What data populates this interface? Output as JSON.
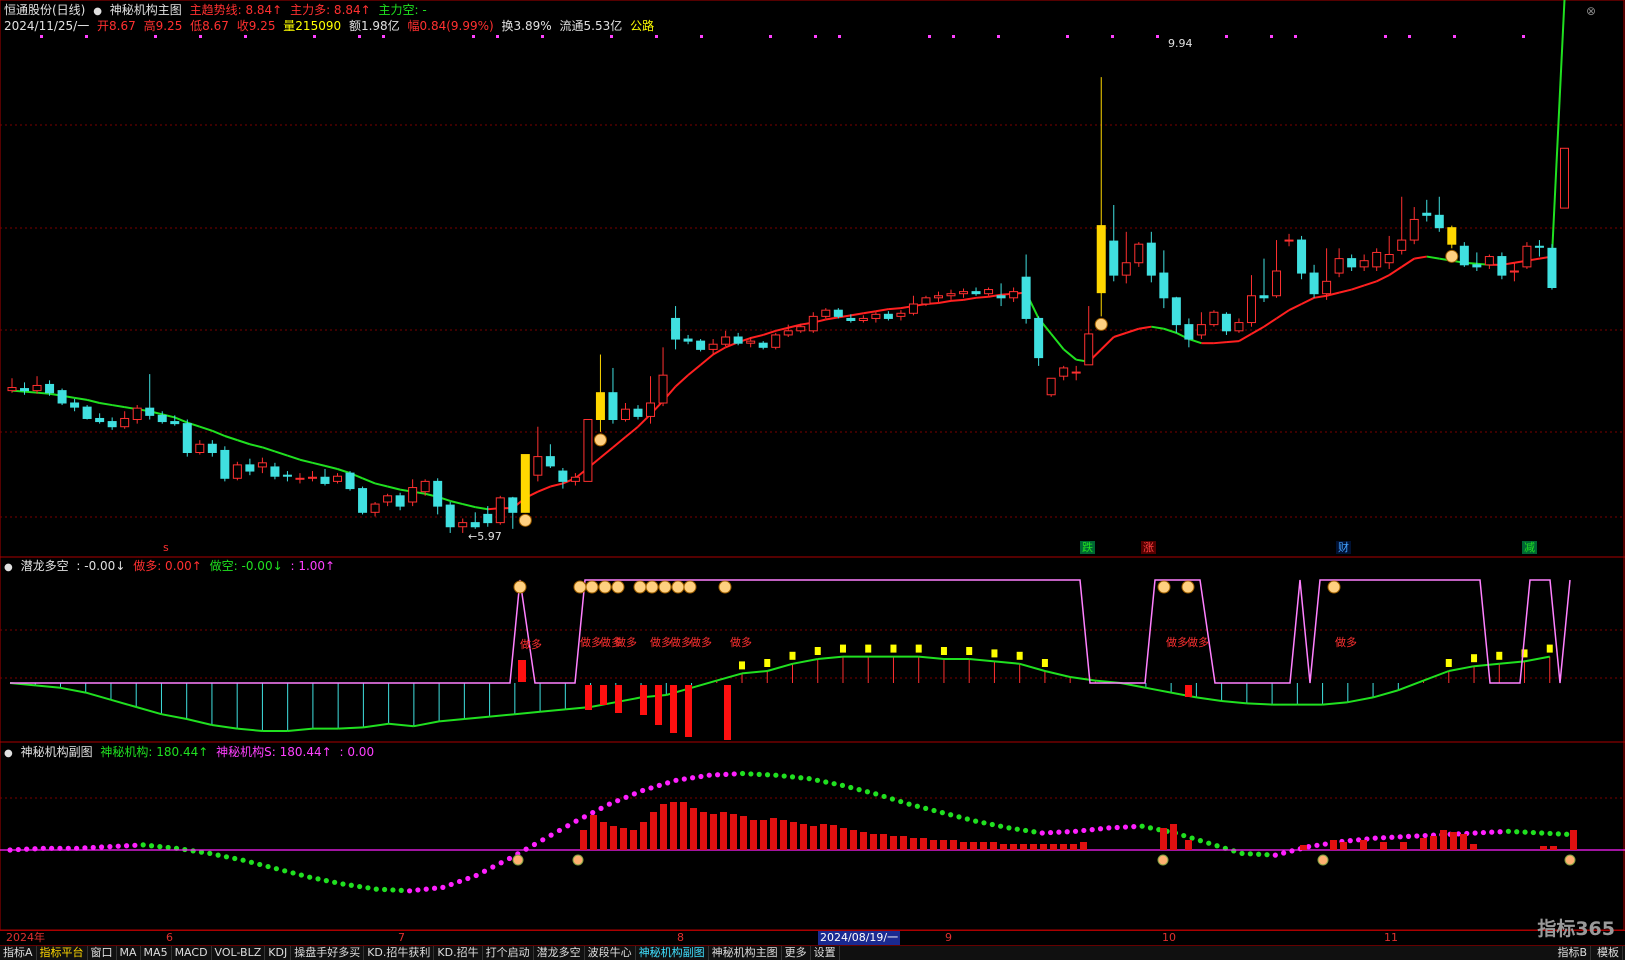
{
  "header": {
    "title": "恒通股份(日线)",
    "indicator": "神秘机构主图",
    "trend_label": "主趋势线: 8.84↑",
    "main_long": "主力多: 8.84↑",
    "main_short": "主力空: -",
    "date": "2024/11/25/一",
    "open": "开8.67",
    "high": "高9.25",
    "low": "低8.67",
    "close": "收9.25",
    "volume": "量215090",
    "amount": "额1.98亿",
    "change": "幅0.84(9.99%)",
    "turnover": "换3.89%",
    "float": "流通5.53亿",
    "concept": "公路"
  },
  "price_labels": {
    "high": "9.94",
    "low": "5.97"
  },
  "event_markers": {
    "s": "s",
    "fall": "跌",
    "rise": "涨",
    "finance": "财",
    "reduce": "减"
  },
  "sub1": {
    "name": "潜龙多空",
    "v0": ": -0.00↓",
    "long": "做多: 0.00↑",
    "short": "做空: -0.00↓",
    "v3": ": 1.00↑",
    "signal_text": "做多"
  },
  "sub2": {
    "name": "神秘机构副图",
    "s1": "神秘机构: 180.44↑",
    "s2": "神秘机构S: 180.44↑",
    "s3": ": 0.00"
  },
  "x_axis": {
    "labels": [
      "2024年",
      "6",
      "7",
      "8",
      "2024/08/19/一",
      "9",
      "10",
      "11"
    ]
  },
  "tabs": [
    "指标A",
    "指标平台",
    "窗口",
    "MA",
    "MA5",
    "MACD",
    "VOL-BLZ",
    "KDJ",
    "操盘手好多买",
    "KD.招牛获利",
    "KD.招牛",
    "打个启动",
    "潜龙多空",
    "波段牛心",
    "神秘机构副图",
    "神秘机构主图",
    "更多",
    "设置"
  ],
  "tabs_right": [
    "指标B",
    "模板"
  ],
  "logo": "指标365",
  "colors": {
    "up": "#ff3030",
    "down": "#40e0e0",
    "ma_up": "#ff2020",
    "ma_down": "#20e020",
    "signal": "#ffd700"
  },
  "chart_data": {
    "type": "candlestick",
    "price_range": [
      5.5,
      10.3
    ],
    "candles": [
      [
        6.9,
        6.93,
        6.88,
        7.02
      ],
      [
        6.92,
        6.9,
        6.86,
        6.98
      ],
      [
        6.9,
        6.95,
        6.87,
        7.04
      ],
      [
        6.96,
        6.88,
        6.85,
        7.0
      ],
      [
        6.9,
        6.78,
        6.76,
        6.92
      ],
      [
        6.78,
        6.74,
        6.7,
        6.82
      ],
      [
        6.74,
        6.63,
        6.62,
        6.76
      ],
      [
        6.63,
        6.6,
        6.58,
        6.68
      ],
      [
        6.6,
        6.55,
        6.52,
        6.64
      ],
      [
        6.55,
        6.63,
        6.53,
        6.7
      ],
      [
        6.62,
        6.73,
        6.58,
        6.76
      ],
      [
        6.73,
        6.66,
        6.62,
        7.06
      ],
      [
        6.66,
        6.6,
        6.58,
        6.7
      ],
      [
        6.6,
        6.58,
        6.56,
        6.66
      ],
      [
        6.58,
        6.3,
        6.26,
        6.62
      ],
      [
        6.3,
        6.38,
        6.28,
        6.42
      ],
      [
        6.38,
        6.3,
        6.26,
        6.42
      ],
      [
        6.32,
        6.05,
        6.02,
        6.36
      ],
      [
        6.05,
        6.18,
        6.03,
        6.21
      ],
      [
        6.18,
        6.12,
        6.08,
        6.24
      ],
      [
        6.16,
        6.2,
        6.1,
        6.25
      ],
      [
        6.16,
        6.07,
        6.04,
        6.2
      ],
      [
        6.08,
        6.07,
        6.02,
        6.12
      ],
      [
        6.05,
        6.05,
        6.0,
        6.1
      ],
      [
        6.05,
        6.06,
        6.02,
        6.12
      ],
      [
        6.06,
        6.0,
        5.98,
        6.14
      ],
      [
        6.02,
        6.07,
        6.0,
        6.1
      ],
      [
        6.1,
        5.95,
        5.93,
        6.12
      ],
      [
        5.95,
        5.72,
        5.7,
        5.97
      ],
      [
        5.72,
        5.8,
        5.68,
        5.82
      ],
      [
        5.82,
        5.88,
        5.78,
        5.9
      ],
      [
        5.88,
        5.78,
        5.74,
        5.91
      ],
      [
        5.82,
        5.96,
        5.78,
        6.04
      ],
      [
        5.92,
        6.02,
        5.88,
        6.04
      ],
      [
        6.02,
        5.78,
        5.7,
        6.05
      ],
      [
        5.79,
        5.58,
        5.52,
        5.82
      ],
      [
        5.58,
        5.62,
        5.52,
        5.66
      ],
      [
        5.62,
        5.58,
        5.56,
        5.72
      ],
      [
        5.7,
        5.62,
        5.58,
        5.78
      ],
      [
        5.62,
        5.86,
        5.6,
        5.88
      ],
      [
        5.86,
        5.72,
        5.56,
        5.87
      ],
      [
        5.72,
        6.28,
        5.72,
        6.28
      ],
      [
        6.08,
        6.26,
        6.02,
        6.55
      ],
      [
        6.26,
        6.17,
        6.15,
        6.38
      ],
      [
        6.12,
        6.02,
        5.95,
        6.15
      ],
      [
        6.02,
        6.06,
        5.98,
        6.1
      ],
      [
        6.02,
        6.62,
        6.02,
        6.62
      ],
      [
        6.62,
        6.88,
        6.5,
        7.25
      ],
      [
        6.88,
        6.62,
        6.58,
        7.12
      ],
      [
        6.62,
        6.72,
        6.6,
        6.78
      ],
      [
        6.72,
        6.65,
        6.62,
        6.76
      ],
      [
        6.65,
        6.78,
        6.58,
        7.04
      ],
      [
        6.78,
        7.05,
        6.75,
        7.32
      ],
      [
        7.6,
        7.4,
        7.3,
        7.72
      ],
      [
        7.4,
        7.38,
        7.35,
        7.44
      ],
      [
        7.38,
        7.3,
        7.28,
        7.4
      ],
      [
        7.3,
        7.35,
        7.25,
        7.4
      ],
      [
        7.35,
        7.42,
        7.33,
        7.48
      ],
      [
        7.42,
        7.36,
        7.34,
        7.46
      ],
      [
        7.36,
        7.38,
        7.32,
        7.42
      ],
      [
        7.36,
        7.32,
        7.3,
        7.38
      ],
      [
        7.32,
        7.44,
        7.3,
        7.46
      ],
      [
        7.44,
        7.48,
        7.42,
        7.54
      ],
      [
        7.48,
        7.52,
        7.46,
        7.55
      ],
      [
        7.48,
        7.62,
        7.46,
        7.66
      ],
      [
        7.62,
        7.68,
        7.6,
        7.7
      ],
      [
        7.68,
        7.62,
        7.6,
        7.7
      ],
      [
        7.6,
        7.58,
        7.56,
        7.64
      ],
      [
        7.58,
        7.6,
        7.56,
        7.63
      ],
      [
        7.6,
        7.64,
        7.56,
        7.66
      ],
      [
        7.64,
        7.6,
        7.58,
        7.67
      ],
      [
        7.62,
        7.65,
        7.58,
        7.68
      ],
      [
        7.65,
        7.74,
        7.63,
        7.82
      ],
      [
        7.74,
        7.8,
        7.72,
        7.82
      ],
      [
        7.8,
        7.82,
        7.76,
        7.86
      ],
      [
        7.82,
        7.84,
        7.78,
        7.88
      ],
      [
        7.84,
        7.86,
        7.8,
        7.89
      ],
      [
        7.86,
        7.84,
        7.82,
        7.9
      ],
      [
        7.84,
        7.88,
        7.82,
        7.9
      ],
      [
        7.82,
        7.8,
        7.72,
        7.94
      ],
      [
        7.8,
        7.86,
        7.76,
        7.9
      ],
      [
        8.0,
        7.6,
        7.55,
        8.22
      ],
      [
        7.6,
        7.22,
        7.14,
        7.62
      ],
      [
        6.86,
        7.02,
        6.84,
        7.02
      ],
      [
        7.04,
        7.12,
        7.0,
        7.14
      ],
      [
        7.08,
        7.08,
        7.0,
        7.14
      ],
      [
        7.15,
        7.45,
        7.15,
        7.72
      ],
      [
        7.85,
        8.5,
        7.62,
        9.94
      ],
      [
        8.35,
        8.02,
        7.96,
        8.7
      ],
      [
        8.02,
        8.14,
        7.94,
        8.44
      ],
      [
        8.14,
        8.32,
        8.1,
        8.34
      ],
      [
        8.33,
        8.02,
        7.95,
        8.44
      ],
      [
        8.04,
        7.8,
        7.7,
        8.26
      ],
      [
        7.8,
        7.54,
        7.46,
        7.81
      ],
      [
        7.54,
        7.4,
        7.32,
        7.6
      ],
      [
        7.44,
        7.54,
        7.4,
        7.66
      ],
      [
        7.54,
        7.66,
        7.52,
        7.68
      ],
      [
        7.64,
        7.48,
        7.44,
        7.66
      ],
      [
        7.48,
        7.56,
        7.46,
        7.6
      ],
      [
        7.56,
        7.82,
        7.52,
        8.02
      ],
      [
        7.82,
        7.8,
        7.76,
        8.18
      ],
      [
        7.82,
        8.06,
        7.8,
        8.36
      ],
      [
        8.36,
        8.36,
        8.3,
        8.42
      ],
      [
        8.36,
        8.04,
        7.98,
        8.4
      ],
      [
        8.04,
        7.84,
        7.8,
        8.12
      ],
      [
        7.84,
        7.96,
        7.78,
        8.28
      ],
      [
        8.04,
        8.18,
        8.0,
        8.28
      ],
      [
        8.18,
        8.1,
        8.06,
        8.22
      ],
      [
        8.1,
        8.16,
        8.06,
        8.22
      ],
      [
        8.1,
        8.24,
        8.06,
        8.28
      ],
      [
        8.14,
        8.22,
        8.08,
        8.4
      ],
      [
        8.26,
        8.36,
        8.22,
        8.78
      ],
      [
        8.36,
        8.56,
        8.32,
        8.68
      ],
      [
        8.62,
        8.6,
        8.54,
        8.75
      ],
      [
        8.6,
        8.48,
        8.44,
        8.78
      ],
      [
        8.48,
        8.32,
        8.28,
        8.5
      ],
      [
        8.3,
        8.12,
        8.1,
        8.34
      ],
      [
        8.12,
        8.1,
        8.06,
        8.24
      ],
      [
        8.12,
        8.2,
        8.08,
        8.22
      ],
      [
        8.2,
        8.02,
        7.98,
        8.24
      ],
      [
        8.05,
        8.06,
        7.96,
        8.14
      ],
      [
        8.1,
        8.3,
        8.08,
        8.34
      ],
      [
        8.3,
        8.29,
        8.2,
        8.36
      ],
      [
        8.28,
        7.9,
        7.88,
        8.32
      ],
      [
        8.67,
        9.25,
        8.67,
        9.25
      ]
    ],
    "ma": [
      6.9,
      6.89,
      6.88,
      6.87,
      6.85,
      6.83,
      6.81,
      6.78,
      6.76,
      6.74,
      6.72,
      6.7,
      6.67,
      6.64,
      6.59,
      6.55,
      6.51,
      6.46,
      6.42,
      6.38,
      6.35,
      6.31,
      6.27,
      6.23,
      6.2,
      6.17,
      6.14,
      6.1,
      6.05,
      6.0,
      5.97,
      5.94,
      5.92,
      5.9,
      5.87,
      5.83,
      5.8,
      5.77,
      5.75,
      5.76,
      5.76,
      5.86,
      5.92,
      5.97,
      6.0,
      6.05,
      6.15,
      6.25,
      6.35,
      6.45,
      6.55,
      6.67,
      6.8,
      6.94,
      7.05,
      7.15,
      7.25,
      7.32,
      7.37,
      7.41,
      7.44,
      7.48,
      7.51,
      7.54,
      7.56,
      7.59,
      7.61,
      7.63,
      7.65,
      7.67,
      7.69,
      7.7,
      7.72,
      7.74,
      7.75,
      7.77,
      7.78,
      7.8,
      7.81,
      7.83,
      7.84,
      7.85,
      7.6,
      7.45,
      7.3,
      7.2,
      7.18,
      7.3,
      7.42,
      7.46,
      7.5,
      7.52,
      7.5,
      7.46,
      7.4,
      7.36,
      7.36,
      7.37,
      7.38,
      7.45,
      7.52,
      7.6,
      7.68,
      7.74,
      7.8,
      7.82,
      7.85,
      7.88,
      7.92,
      7.96,
      8.02,
      8.1,
      8.18,
      8.2,
      8.18,
      8.16,
      8.14,
      8.13,
      8.12,
      8.12,
      8.14,
      8.16,
      8.18,
      8.2
    ],
    "ma_colors": [
      "red",
      "green",
      "red",
      "green"
    ],
    "osc1": [
      0.0,
      -0.02,
      -0.04,
      -0.08,
      -0.14,
      -0.2,
      -0.26,
      -0.3,
      -0.35,
      -0.38,
      -0.4,
      -0.4,
      -0.38,
      -0.38,
      -0.37,
      -0.34,
      -0.36,
      -0.32,
      -0.3,
      -0.28,
      -0.26,
      -0.24,
      -0.22,
      -0.2,
      -0.16,
      -0.12,
      -0.1,
      -0.04,
      0.02,
      0.08,
      0.1,
      0.16,
      0.2,
      0.22,
      0.22,
      0.22,
      0.22,
      0.2,
      0.2,
      0.18,
      0.16,
      0.1,
      0.05,
      0.02,
      0.0,
      -0.04,
      -0.08,
      -0.12,
      -0.15,
      -0.17,
      -0.18,
      -0.18,
      -0.18,
      -0.16,
      -0.12,
      -0.06,
      0.02,
      0.1,
      0.14,
      0.16,
      0.18,
      0.22
    ],
    "sub2_line": [
      0.0,
      0.02,
      0.02,
      0.04,
      0.06,
      0.02,
      -0.04,
      -0.12,
      -0.22,
      -0.32,
      -0.4,
      -0.46,
      -0.48,
      -0.44,
      -0.3,
      -0.1,
      0.12,
      0.34,
      0.54,
      0.7,
      0.82,
      0.88,
      0.9,
      0.88,
      0.84,
      0.76,
      0.66,
      0.54,
      0.44,
      0.34,
      0.26,
      0.2,
      0.22,
      0.26,
      0.28,
      0.2,
      0.08,
      -0.04,
      -0.06,
      0.04,
      0.1,
      0.14,
      0.16,
      0.18,
      0.2,
      0.22,
      0.2,
      0.18
    ]
  }
}
